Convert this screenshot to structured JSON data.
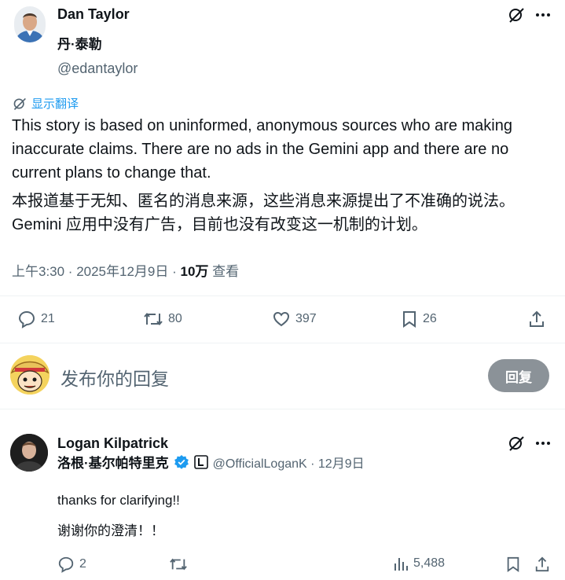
{
  "main_tweet": {
    "author_name": "Dan Taylor",
    "author_name_cn": "丹·泰勒",
    "handle": "@edantaylor",
    "translate_label": "显示翻译",
    "text_en": "This story is based on uninformed, anonymous sources who are making inaccurate claims. There are no ads in the Gemini app and there are no current plans to change that.",
    "text_cn": "本报道基于无知、匿名的消息来源，这些消息来源提出了不准确的说法。Gemini 应用中没有广告，目前也没有改变这一机制的计划。",
    "time": "上午3:30 · 2025年12月9日 · ",
    "views_count": "10万",
    "views_label": " 查看",
    "replies": "21",
    "reposts": "80",
    "likes": "397",
    "bookmarks": "26"
  },
  "reply_box": {
    "placeholder": "发布你的回复",
    "button_label": "回复"
  },
  "reply_tweet": {
    "author_name": "Logan Kilpatrick",
    "author_name_cn": "洛根·基尔帕特里克",
    "handle": "@OfficialLoganK · 12月9日",
    "text_en": "thanks for clarifying!!",
    "text_cn": "谢谢你的澄清！！",
    "replies": "2",
    "views": "5,488"
  },
  "colors": {
    "verified_blue": "#1d9bf0",
    "text": "#0f1419",
    "muted": "#536471"
  },
  "icons": [
    "grok-icon",
    "more-icon",
    "translate-icon",
    "reply-icon",
    "repost-icon",
    "like-icon",
    "bookmark-icon",
    "share-icon",
    "verified-icon",
    "affiliate-icon",
    "views-icon"
  ]
}
